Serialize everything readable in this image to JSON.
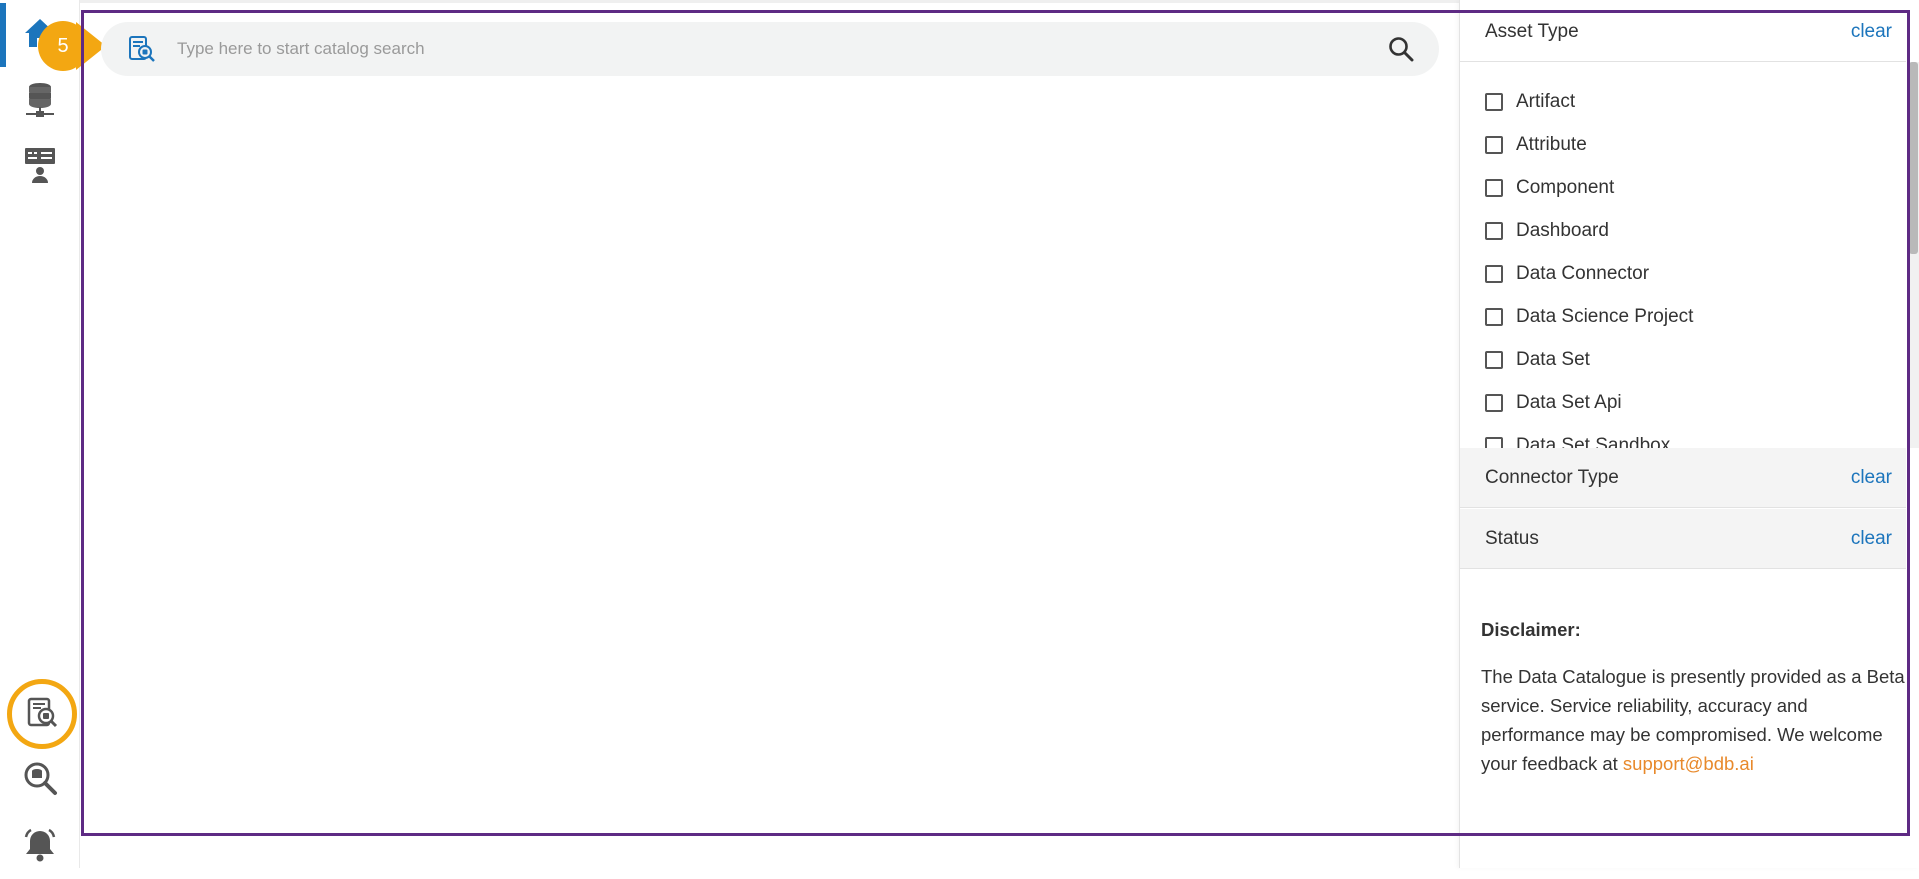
{
  "tutorial": {
    "step_number": "5"
  },
  "sidebar": {
    "items": [
      {
        "name": "home",
        "icon": "home-icon",
        "active": true
      },
      {
        "name": "data-center",
        "icon": "database-network-icon"
      },
      {
        "name": "data-science",
        "icon": "presentation-user-icon"
      },
      {
        "name": "data-catalog",
        "icon": "catalog-search-icon",
        "highlighted": true
      },
      {
        "name": "search",
        "icon": "search-database-icon"
      },
      {
        "name": "notifications",
        "icon": "bell-icon"
      }
    ]
  },
  "search": {
    "placeholder": "Type here to start catalog search",
    "value": ""
  },
  "filters": {
    "asset_type": {
      "title": "Asset Type",
      "clear_label": "clear",
      "options": [
        "Artifact",
        "Attribute",
        "Component",
        "Dashboard",
        "Data Connector",
        "Data Science Project",
        "Data Set",
        "Data Set Api",
        "Data Set Sandbox"
      ]
    },
    "connector_type": {
      "title": "Connector Type",
      "clear_label": "clear"
    },
    "status": {
      "title": "Status",
      "clear_label": "clear"
    }
  },
  "disclaimer": {
    "title": "Disclaimer:",
    "text": "The Data Catalogue is presently provided as a Beta service. Service reliability, accuracy and performance may be compromised. We welcome your feedback at ",
    "email": "support@bdb.ai"
  },
  "colors": {
    "accent_blue": "#1c75bc",
    "highlight_orange": "#f3a712",
    "frame_purple": "#5e2a84",
    "link_orange": "#e8892b"
  }
}
